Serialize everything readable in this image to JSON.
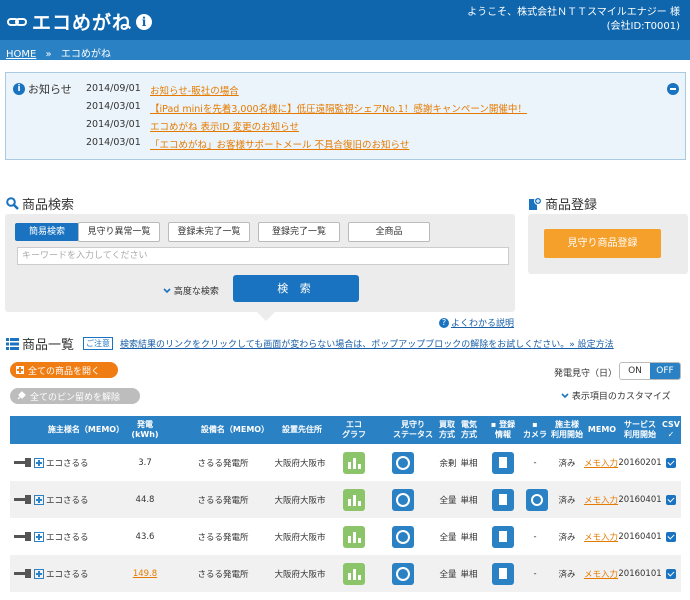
{
  "header": {
    "app_title": "エコめがね",
    "welcome_line1": "ようこそ、株式会社ＮＴＴスマイルエナジー 様",
    "welcome_line2": "(会社ID:T0001)"
  },
  "breadcrumb": {
    "home": "HOME",
    "separator": "»",
    "current": "エコめがね"
  },
  "news": {
    "title": "お知らせ",
    "items": [
      {
        "date": "2014/09/01",
        "text": "お知らせ-販社の場合"
      },
      {
        "date": "2014/03/01",
        "text": "【iPad miniを先着3,000名様に】低圧遠隔監視シェアNo.1！感謝キャンペーン開催中！"
      },
      {
        "date": "2014/03/01",
        "text": "エコめがね 表示ID 変更のお知らせ"
      },
      {
        "date": "2014/03/01",
        "text": "「エコめがね」お客様サポートメール 不具合復旧のお知らせ"
      }
    ]
  },
  "search": {
    "title": "商品検索",
    "tabs": [
      "簡易検索",
      "見守り異常一覧",
      "登録未完了一覧",
      "登録完了一覧",
      "全商品"
    ],
    "placeholder": "キーワードを入力してください",
    "advanced_label": "高度な検索",
    "search_button": "検 索",
    "help_link": "よくわかる説明"
  },
  "register": {
    "title": "商品登録",
    "button": "見守り商品登録"
  },
  "list": {
    "title": "商品一覧",
    "notice_badge": "ご注意",
    "notice_text": "検索結果のリンクをクリックしても画面が変わらない場合は、ポップアップブロックの解除をお試しください。» 設定方法",
    "open_all": "全ての商品を開く",
    "unpin_all": "全てのピン留めを解除",
    "watch_label": "発電見守（日）",
    "toggle_on": "ON",
    "toggle_off": "OFF",
    "customize": "表示項目のカスタマイズ"
  },
  "table": {
    "headers": {
      "owner": "施主様名（MEMO）",
      "kwh1": "発電",
      "kwh2": "(kWh)",
      "device": "設備名（MEMO）",
      "location": "設置先住所",
      "graph1": "エコ",
      "graph2": "グラフ",
      "watch1": "見守り",
      "watch2": "ステータス",
      "buy1": "買取",
      "buy2": "方式",
      "elec1": "電気",
      "elec2": "方式",
      "reg1": "登録",
      "reg2": "情報",
      "camera": "カメラ",
      "start1": "施主様",
      "start2": "利用開始",
      "memo": "MEMO",
      "service1": "サービス",
      "service2": "利用開始",
      "csv": "CSV"
    },
    "rows": [
      {
        "owner": "エコさるる",
        "kwh": "3.7",
        "device": "さるる発電所",
        "location": "大阪府大阪市",
        "buy": "余剰",
        "elec": "単相",
        "camera": "-",
        "started": "済み",
        "memo": "メモ入力",
        "service_start": "20160201"
      },
      {
        "owner": "エコさるる",
        "kwh": "44.8",
        "device": "さるる発電所",
        "location": "大阪府大阪市",
        "buy": "全量",
        "elec": "単相",
        "camera": "",
        "started": "済み",
        "memo": "メモ入力",
        "service_start": "20160401"
      },
      {
        "owner": "エコさるる",
        "kwh": "43.6",
        "device": "さるる発電所",
        "location": "大阪府大阪市",
        "buy": "全量",
        "elec": "単相",
        "camera": "-",
        "started": "済み",
        "memo": "メモ入力",
        "service_start": "20160401"
      },
      {
        "owner": "エコさるる",
        "kwh": "149.8",
        "device": "さるる発電所",
        "location": "大阪府大阪市",
        "buy": "全量",
        "elec": "単相",
        "camera": "-",
        "started": "済み",
        "memo": "メモ入力",
        "service_start": "20160101"
      }
    ]
  }
}
